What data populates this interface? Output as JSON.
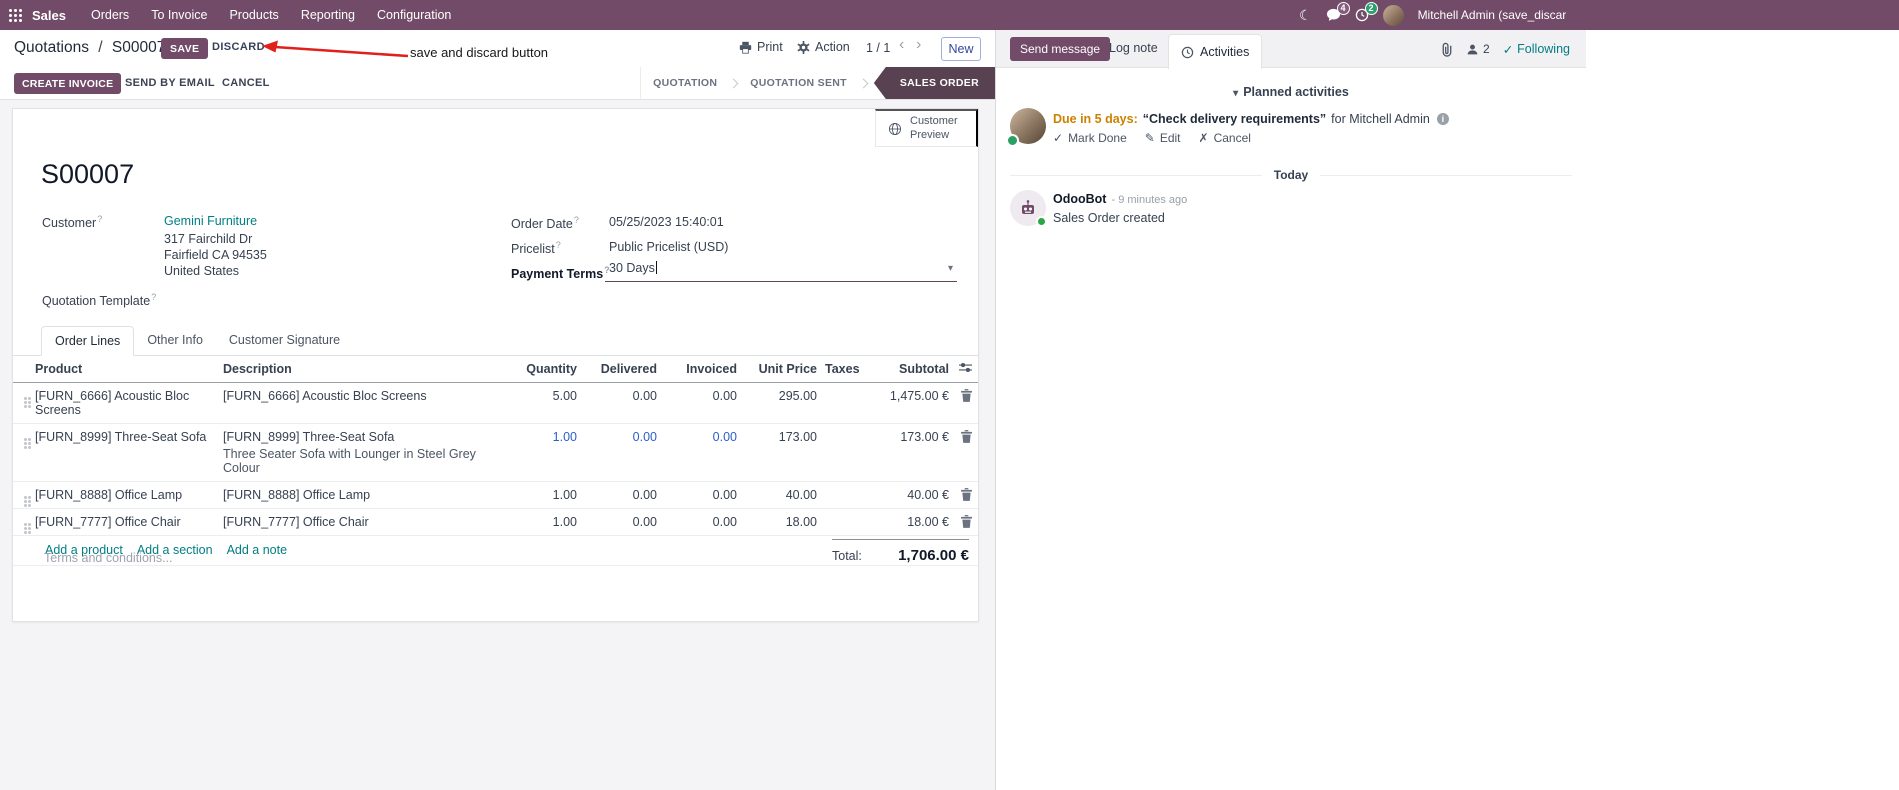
{
  "colors": {
    "brand_primary": "#714B67",
    "stage_active_bg": "#584150",
    "link_teal": "#017e84",
    "dirty_cell_blue": "#2a60c8",
    "activity_due_orange": "#cc8100",
    "annotation_red": "#e0201b"
  },
  "icons": {
    "moon": "☾",
    "caret_down": "▾",
    "caret_prev": "‹",
    "caret_next": "›",
    "check": "✓",
    "edit_pencil": "✎",
    "cancel_x": "✗"
  },
  "navbar": {
    "app_name": "Sales",
    "menus": [
      "Orders",
      "To Invoice",
      "Products",
      "Reporting",
      "Configuration"
    ],
    "message_badge": "4",
    "activity_badge": "2",
    "user_name": "Mitchell Admin (save_discar"
  },
  "control_panel": {
    "breadcrumb_parent": "Quotations",
    "breadcrumb_sep": "/",
    "breadcrumb_current": "S00007",
    "save": "SAVE",
    "discard": "DISCARD",
    "print": "Print",
    "action": "Action",
    "pager": "1 / 1",
    "new": "New"
  },
  "annotation": {
    "text": "save and discard button"
  },
  "statusbar": {
    "create_invoice": "CREATE INVOICE",
    "send_by_email": "SEND BY EMAIL",
    "cancel": "CANCEL",
    "stages": [
      "QUOTATION",
      "QUOTATION SENT",
      "SALES ORDER"
    ],
    "active_stage": "SALES ORDER"
  },
  "sheet": {
    "customer_preview": "Customer Preview",
    "title": "S00007",
    "help_marker": "?",
    "customer_label": "Customer",
    "customer_name": "Gemini Furniture",
    "address_line1": "317 Fairchild Dr",
    "address_line2": "Fairfield CA 94535",
    "address_line3": "United States",
    "quotation_template_label": "Quotation Template",
    "order_date_label": "Order Date",
    "order_date_value": "05/25/2023 15:40:01",
    "pricelist_label": "Pricelist",
    "pricelist_value": "Public Pricelist (USD)",
    "payment_terms_label": "Payment Terms",
    "payment_terms_value": "30 Days",
    "tabs": [
      "Order Lines",
      "Other Info",
      "Customer Signature"
    ],
    "table": {
      "headers": {
        "product": "Product",
        "description": "Description",
        "quantity": "Quantity",
        "delivered": "Delivered",
        "invoiced": "Invoiced",
        "unit_price": "Unit Price",
        "taxes": "Taxes",
        "subtotal": "Subtotal"
      },
      "rows": [
        {
          "product": "[FURN_6666] Acoustic Bloc Screens",
          "description": "[FURN_6666] Acoustic Bloc Screens",
          "quantity": "5.00",
          "delivered": "0.00",
          "invoiced": "0.00",
          "unit_price": "295.00",
          "taxes": "",
          "subtotal": "1,475.00 €"
        },
        {
          "product": "[FURN_8999] Three-Seat Sofa",
          "description": "[FURN_8999] Three-Seat Sofa",
          "description_note": "Three Seater Sofa with Lounger in Steel Grey Colour",
          "quantity": "1.00",
          "delivered": "0.00",
          "invoiced": "0.00",
          "unit_price": "173.00",
          "taxes": "",
          "subtotal": "173.00 €"
        },
        {
          "product": "[FURN_8888] Office Lamp",
          "description": "[FURN_8888] Office Lamp",
          "quantity": "1.00",
          "delivered": "0.00",
          "invoiced": "0.00",
          "unit_price": "40.00",
          "taxes": "",
          "subtotal": "40.00 €"
        },
        {
          "product": "[FURN_7777] Office Chair",
          "description": "[FURN_7777] Office Chair",
          "quantity": "1.00",
          "delivered": "0.00",
          "invoiced": "0.00",
          "unit_price": "18.00",
          "taxes": "",
          "subtotal": "18.00 €"
        }
      ],
      "add_product": "Add a product",
      "add_section": "Add a section",
      "add_note": "Add a note"
    },
    "terms_placeholder": "Terms and conditions...",
    "total_label": "Total:",
    "total_value": "1,706.00 €"
  },
  "chatter": {
    "send_message": "Send message",
    "log_note": "Log note",
    "activities": "Activities",
    "follower_count": "2",
    "following": "Following",
    "planned_activities": "Planned activities",
    "activity": {
      "due": "Due in 5 days:",
      "summary": "“Check delivery requirements”",
      "assignee": "for Mitchell Admin",
      "mark_done": "Mark Done",
      "edit": "Edit",
      "cancel": "Cancel"
    },
    "date_divider": "Today",
    "message": {
      "author": "OdooBot",
      "time": "- 9 minutes ago",
      "body": "Sales Order created"
    }
  }
}
